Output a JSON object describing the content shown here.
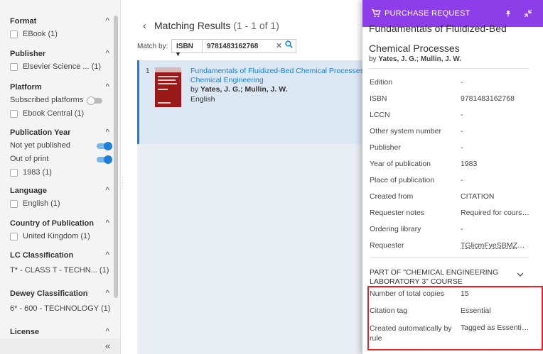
{
  "sidebar": {
    "facets": [
      {
        "title": "Format",
        "items": [
          {
            "label": "EBook (1)"
          }
        ]
      },
      {
        "title": "Publisher",
        "items": [
          {
            "label": "Elsevier Science ... (1)"
          }
        ]
      },
      {
        "title": "Platform",
        "toggles": [
          {
            "label": "Subscribed platforms",
            "state": "off"
          }
        ],
        "items": [
          {
            "label": "Ebook Central (1)"
          }
        ]
      },
      {
        "title": "Publication Year",
        "toggles": [
          {
            "label": "Not yet published",
            "state": "on"
          },
          {
            "label": "Out of print",
            "state": "on"
          }
        ],
        "items": [
          {
            "label": "1983 (1)"
          }
        ]
      },
      {
        "title": "Language",
        "items": [
          {
            "label": "English (1)"
          }
        ]
      },
      {
        "title": "Country of Publication",
        "items": [
          {
            "label": "United Kingdom (1)"
          }
        ]
      },
      {
        "title": "LC Classification",
        "text_items": [
          "T* - CLASS T - TECHN... (1)"
        ]
      },
      {
        "title": "Dewey Classification",
        "text_items": [
          "6* - 600 - TECHNOLOGY (1)"
        ]
      },
      {
        "title": "License"
      }
    ],
    "collapse_icon": "double-chevron-left-icon"
  },
  "main": {
    "title": "Matching Results",
    "count": "(1 - 1 of 1)",
    "match_by_label": "Match by:",
    "match_by_value": "ISBN ▾",
    "search_value": "9781483162768",
    "result": {
      "index": "1",
      "title": "Fundamentals of Fluidized-Bed Chemical Processes: Butterworths Monographs in",
      "title_line2": "Chemical Engineering",
      "by": "by",
      "authors": "Yates, J. G.; Mullin, J. W.",
      "language": "English",
      "cover_title": "Fundamentals of Fluidized-Bed Chemical Processes",
      "cover_author": "J. G. Yates"
    }
  },
  "drawer": {
    "header_title": "PURCHASE REQUEST",
    "book_title_cut": "Fundamentals of Fluidized-Bed",
    "book_title": "Chemical Processes",
    "byline_by": "by",
    "byline_authors": "Yates, J. G.; Mullin, J. W.",
    "details": [
      {
        "label": "Edition",
        "value": "-"
      },
      {
        "label": "ISBN",
        "value": "9781483162768"
      },
      {
        "label": "LCCN",
        "value": "-"
      },
      {
        "label": "Other system number",
        "value": "-"
      },
      {
        "label": "Publisher",
        "value": "-"
      },
      {
        "label": "Year of publication",
        "value": "1983"
      },
      {
        "label": "Place of publication",
        "value": "-"
      },
      {
        "label": "Created from",
        "value": "CITATION"
      },
      {
        "label": "Requester notes",
        "value": "Required for course C..."
      },
      {
        "label": "Ordering library",
        "value": "-"
      },
      {
        "label": "Requester",
        "value": "TGlicmFyeSBMZWFy..."
      }
    ],
    "section_title": "PART OF \"CHEMICAL ENGINEERING LABORATORY 3\" COURSE",
    "course_details": [
      {
        "label": "Number of total copies",
        "value": "15"
      },
      {
        "label": "Citation tag",
        "value": "Essential"
      },
      {
        "label": "Created automatically by rule",
        "value": "Tagged as Essential, I..."
      }
    ]
  },
  "colors": {
    "accent": "#1e7fd9",
    "drawer_header": "#8d3ee8",
    "highlight": "#e0242b"
  }
}
